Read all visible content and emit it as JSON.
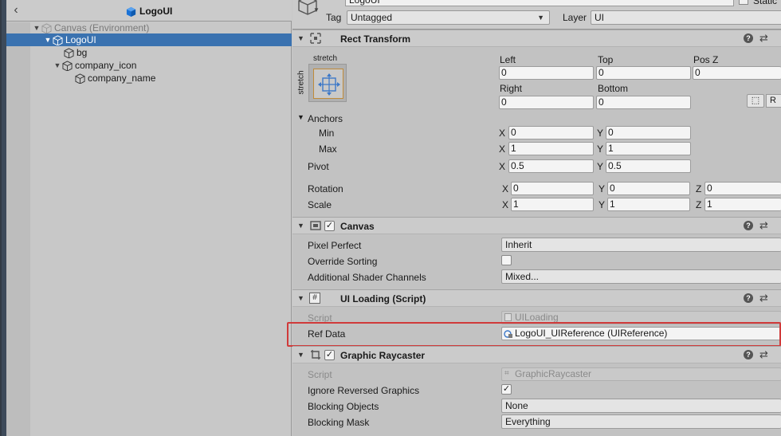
{
  "hierarchy": {
    "title": "LogoUI",
    "items": [
      {
        "label": "Canvas (Environment)",
        "depth": 0,
        "expanded": true,
        "selected": false,
        "env": true
      },
      {
        "label": "LogoUI",
        "depth": 1,
        "expanded": true,
        "selected": true,
        "env": false
      },
      {
        "label": "bg",
        "depth": 2,
        "expanded": false,
        "selected": false,
        "env": false
      },
      {
        "label": "company_icon",
        "depth": 2,
        "expanded": true,
        "selected": false,
        "env": false
      },
      {
        "label": "company_name",
        "depth": 3,
        "expanded": false,
        "selected": false,
        "env": false
      }
    ]
  },
  "inspector": {
    "name": "LogoUI",
    "static_label": "Static",
    "tag_label": "Tag",
    "tag_value": "Untagged",
    "layer_label": "Layer",
    "layer_value": "UI",
    "rect_transform": {
      "title": "Rect Transform",
      "anchor_preset_top": "stretch",
      "anchor_preset_side": "stretch",
      "left_label": "Left",
      "left": "0",
      "top_label": "Top",
      "top": "0",
      "posz_label": "Pos Z",
      "posz": "0",
      "right_label": "Right",
      "right": "0",
      "bottom_label": "Bottom",
      "bottom": "0",
      "r_button": "R",
      "anchors_label": "Anchors",
      "min_label": "Min",
      "min_x": "0",
      "min_y": "0",
      "max_label": "Max",
      "max_x": "1",
      "max_y": "1",
      "pivot_label": "Pivot",
      "pivot_x": "0.5",
      "pivot_y": "0.5",
      "rotation_label": "Rotation",
      "rot_x": "0",
      "rot_y": "0",
      "rot_z": "0",
      "scale_label": "Scale",
      "scale_x": "1",
      "scale_y": "1",
      "scale_z": "1",
      "x": "X",
      "y": "Y",
      "z": "Z"
    },
    "canvas": {
      "title": "Canvas",
      "pixel_perfect_label": "Pixel Perfect",
      "pixel_perfect": "Inherit",
      "override_sorting_label": "Override Sorting",
      "shader_channels_label": "Additional Shader Channels",
      "shader_channels": "Mixed..."
    },
    "ui_loading": {
      "title": "UI Loading (Script)",
      "script_label": "Script",
      "script_value": "UILoading",
      "ref_data_label": "Ref Data",
      "ref_data_value": "LogoUI_UIReference (UIReference)"
    },
    "graphic_raycaster": {
      "title": "Graphic Raycaster",
      "script_label": "Script",
      "script_value": "GraphicRaycaster",
      "ignore_reversed_label": "Ignore Reversed Graphics",
      "blocking_objects_label": "Blocking Objects",
      "blocking_objects": "None",
      "blocking_mask_label": "Blocking Mask",
      "blocking_mask": "Everything"
    }
  },
  "colors": {
    "selection": "#3a72b0",
    "highlight": "#d03a3a",
    "cube_icon": "#1b72d6"
  }
}
